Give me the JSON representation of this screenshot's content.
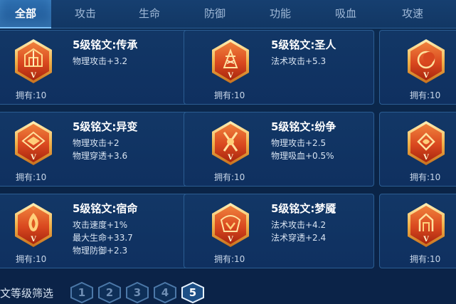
{
  "tabs": [
    {
      "label": "全部",
      "active": true
    },
    {
      "label": "攻击",
      "active": false
    },
    {
      "label": "生命",
      "active": false
    },
    {
      "label": "防御",
      "active": false
    },
    {
      "label": "功能",
      "active": false
    },
    {
      "label": "吸血",
      "active": false
    },
    {
      "label": "攻速",
      "active": false
    }
  ],
  "cards": [
    {
      "name": "5级铭文:传承",
      "stats": [
        "物理攻击+3.2"
      ],
      "owned": "拥有:10",
      "icon": "inheritance-rune-icon"
    },
    {
      "name": "5级铭文:圣人",
      "stats": [
        "法术攻击+5.3"
      ],
      "owned": "拥有:10",
      "icon": "sage-rune-icon"
    },
    {
      "name": "",
      "stats": [],
      "owned": "拥有:10",
      "icon": "crescent-rune-icon"
    },
    {
      "name": "5级铭文:异变",
      "stats": [
        "物理攻击+2",
        "物理穿透+3.6"
      ],
      "owned": "拥有:10",
      "icon": "mutation-rune-icon"
    },
    {
      "name": "5级铭文:纷争",
      "stats": [
        "物理攻击+2.5",
        "物理吸血+0.5%"
      ],
      "owned": "拥有:10",
      "icon": "strife-rune-icon"
    },
    {
      "name": "",
      "stats": [],
      "owned": "拥有:10",
      "icon": "swirl-rune-icon"
    },
    {
      "name": "5级铭文:宿命",
      "stats": [
        "攻击速度+1%",
        "最大生命+33.7",
        "物理防御+2.3"
      ],
      "owned": "拥有:10",
      "icon": "destiny-rune-icon"
    },
    {
      "name": "5级铭文:梦魇",
      "stats": [
        "法术攻击+4.2",
        "法术穿透+2.4"
      ],
      "owned": "拥有:10",
      "icon": "nightmare-rune-icon"
    },
    {
      "name": "",
      "stats": [],
      "owned": "拥有:10",
      "icon": "gate-rune-icon"
    }
  ],
  "rune_level_mark": "V",
  "filter": {
    "label": "文等级筛选",
    "levels": [
      "1",
      "2",
      "3",
      "4",
      "5"
    ],
    "selected": "5"
  },
  "colors": {
    "accent": "#7fc4ff",
    "rune_orange": "#e4572a",
    "rune_gold": "#f3c46a"
  }
}
